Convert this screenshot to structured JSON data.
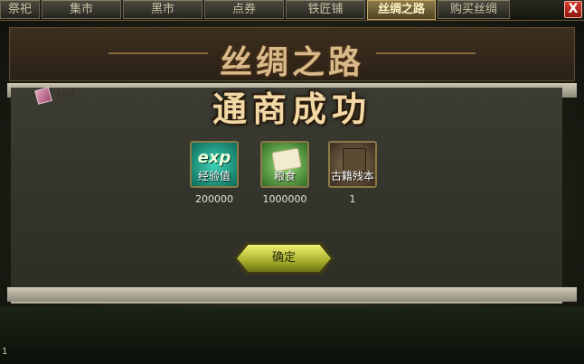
{
  "tabs": [
    {
      "label": "祭祀",
      "active": false
    },
    {
      "label": "集市",
      "active": false
    },
    {
      "label": "黑市",
      "active": false
    },
    {
      "label": "点券",
      "active": false
    },
    {
      "label": "铁匠铺",
      "active": false
    },
    {
      "label": "丝绸之路",
      "active": true
    },
    {
      "label": "购买丝绸",
      "active": false
    }
  ],
  "close_label": "X",
  "title": "丝绸之路",
  "counter": {
    "icon": "silk-scroll-icon",
    "value": "104"
  },
  "success_title": "通商成功",
  "rewards": [
    {
      "icon": "exp-icon",
      "glyph": "exp",
      "name": "经验值",
      "count": "200000"
    },
    {
      "icon": "grain-icon",
      "name": "粮食",
      "count": "1000000"
    },
    {
      "icon": "ancient-book-icon",
      "name": "古籍残本",
      "count": "1"
    }
  ],
  "confirm_label": "确定",
  "corner_mark": "1",
  "colors": {
    "accent_gold": "#d8b98a",
    "confirm_green": "#a8b02c",
    "close_red": "#d43b2e"
  }
}
